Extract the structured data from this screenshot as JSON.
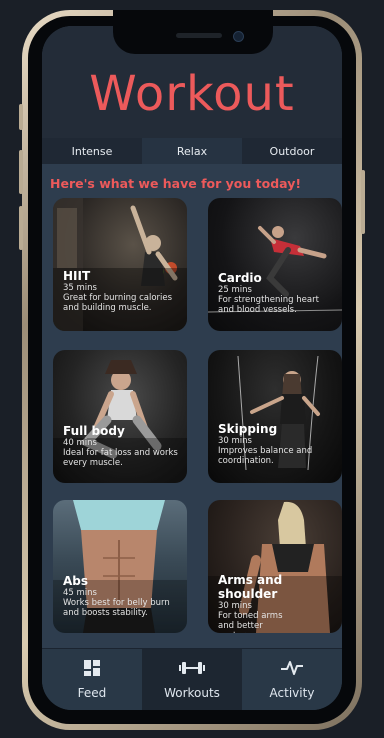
{
  "header": {
    "title": "Workout"
  },
  "tabs": [
    {
      "label": "Intense"
    },
    {
      "label": "Relax"
    },
    {
      "label": "Outdoor"
    }
  ],
  "subtitle": "Here's what we have for you today!",
  "cards": [
    {
      "name": "HIIT",
      "duration": "35 mins",
      "description": "Great for burning calories and building muscle."
    },
    {
      "name": "Cardio",
      "duration": "25 mins",
      "description": "For strengthening heart and blood vessels."
    },
    {
      "name": "Full body",
      "duration": "40 mins",
      "description": "Ideal for fat loss and works every muscle."
    },
    {
      "name": "Skipping",
      "duration": "30 mins",
      "description": "Improves balance and coordination."
    },
    {
      "name": "Abs",
      "duration": "45 mins",
      "description": "Works best for belly burn and boosts stability."
    },
    {
      "name": "Arms and shoulder",
      "duration": "30 mins",
      "description": "For toned arms and better posture."
    }
  ],
  "nav": [
    {
      "label": "Feed",
      "icon": "grid-icon"
    },
    {
      "label": "Workouts",
      "icon": "dumbbell-icon"
    },
    {
      "label": "Activity",
      "icon": "pulse-icon"
    }
  ],
  "colors": {
    "accent": "#ec5a5b",
    "screen_bg": "#2e3d4e",
    "frame": "#d9cbb0"
  }
}
